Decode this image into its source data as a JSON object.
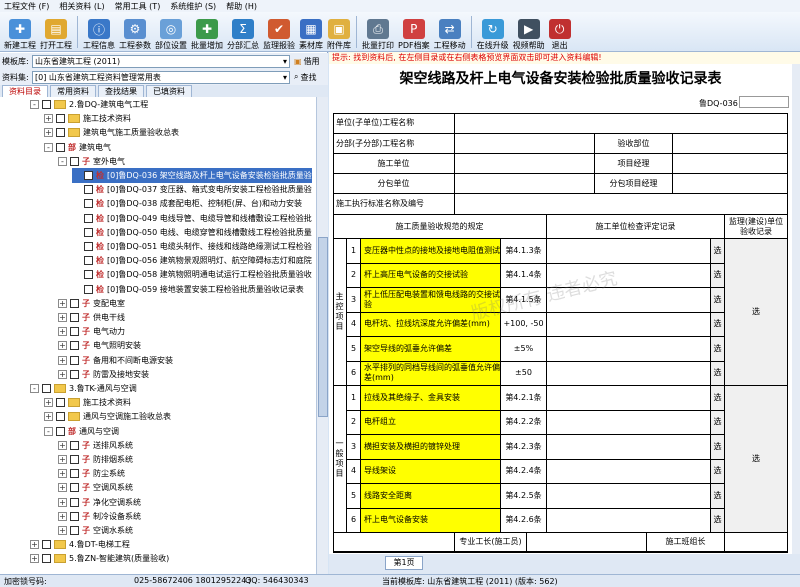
{
  "menu": [
    "工程文件 (F)",
    "相关资料 (L)",
    "常用工具 (T)",
    "系统维护 (S)",
    "帮助 (H)"
  ],
  "toolbar": [
    {
      "label": "新建工程",
      "icon": "new-project-icon",
      "color": "#4a90d9"
    },
    {
      "label": "打开工程",
      "icon": "open-project-icon",
      "color": "#e0a830"
    },
    {
      "label": "工程信息",
      "icon": "project-info-icon",
      "color": "#3a78c8"
    },
    {
      "label": "工程参数",
      "icon": "project-params-icon",
      "color": "#5a8fd0"
    },
    {
      "label": "部位设置",
      "icon": "position-settings-icon",
      "color": "#6aa0d8"
    },
    {
      "label": "批量增加",
      "icon": "batch-add-icon",
      "color": "#3c9a4a"
    },
    {
      "label": "分部汇总",
      "icon": "summary-icon",
      "color": "#2f7fc8"
    },
    {
      "label": "监理报验",
      "icon": "supervision-icon",
      "color": "#d05a30"
    },
    {
      "label": "素材库",
      "icon": "material-library-icon",
      "color": "#3a6fc4"
    },
    {
      "label": "附件库",
      "icon": "attachment-library-icon",
      "color": "#e0b040"
    },
    {
      "label": "批量打印",
      "icon": "batch-print-icon",
      "color": "#607890"
    },
    {
      "label": "PDF档案",
      "icon": "pdf-archive-icon",
      "color": "#d04040"
    },
    {
      "label": "工程移动",
      "icon": "project-move-icon",
      "color": "#4a80c0"
    },
    {
      "label": "在线升级",
      "icon": "online-upgrade-icon",
      "color": "#3a9ad8"
    },
    {
      "label": "视频帮助",
      "icon": "video-help-icon",
      "color": "#405060"
    },
    {
      "label": "退出",
      "icon": "exit-icon",
      "color": "#c03030"
    }
  ],
  "template_library": {
    "label": "模板库:",
    "value": "山东省建筑工程 (2011)",
    "action": "借用"
  },
  "data_set": {
    "label": "资料集:",
    "value": "[0] 山东省建筑工程资料管理常用表",
    "action": "查找"
  },
  "tabs": [
    "资料目录",
    "常用资料",
    "查找结果",
    "已填资料"
  ],
  "tree": [
    {
      "indent": 30,
      "text": "2.鲁DQ-建筑电气工程",
      "type": "folder",
      "exp": "-"
    },
    {
      "indent": 44,
      "text": "施工技术资料",
      "type": "folder",
      "exp": "+"
    },
    {
      "indent": 44,
      "text": "建筑电气施工质量验收总表",
      "type": "folder",
      "exp": "+"
    },
    {
      "indent": 44,
      "text": "建筑电气",
      "type": "badge",
      "badge": "部",
      "exp": "-"
    },
    {
      "indent": 58,
      "text": "室外电气",
      "type": "badge",
      "badge": "子",
      "exp": "-"
    },
    {
      "indent": 72,
      "text": "[0]鲁DQ-036 架空线路及杆上电气设备安装检验批质量验",
      "type": "badge",
      "badge": "检",
      "sel": true
    },
    {
      "indent": 72,
      "text": "[0]鲁DQ-037 变压器、箱式变电所安装工程检验批质量验",
      "type": "badge",
      "badge": "检"
    },
    {
      "indent": 72,
      "text": "[0]鲁DQ-038 成套配电柜、控制柜(屏、台)和动力安装",
      "type": "badge",
      "badge": "检"
    },
    {
      "indent": 72,
      "text": "[0]鲁DQ-049 电线导管、电缆导管和线槽敷设工程检验批",
      "type": "badge",
      "badge": "检"
    },
    {
      "indent": 72,
      "text": "[0]鲁DQ-050 电线、电缆穿管和线槽敷线工程检验批质量",
      "type": "badge",
      "badge": "检"
    },
    {
      "indent": 72,
      "text": "[0]鲁DQ-051 电缆头制作、接线和线路绝缘测试工程检验",
      "type": "badge",
      "badge": "检"
    },
    {
      "indent": 72,
      "text": "[0]鲁DQ-056 建筑物景观照明灯、航空障碍标志灯和庭院",
      "type": "badge",
      "badge": "检"
    },
    {
      "indent": 72,
      "text": "[0]鲁DQ-058 建筑物照明通电试运行工程检验批质量验收",
      "type": "badge",
      "badge": "检"
    },
    {
      "indent": 72,
      "text": "[0]鲁DQ-059 接地装置安装工程检验批质量验收记录表",
      "type": "badge",
      "badge": "检"
    },
    {
      "indent": 58,
      "text": "变配电室",
      "type": "badge",
      "badge": "子",
      "exp": "+"
    },
    {
      "indent": 58,
      "text": "供电干线",
      "type": "badge",
      "badge": "子",
      "exp": "+"
    },
    {
      "indent": 58,
      "text": "电气动力",
      "type": "badge",
      "badge": "子",
      "exp": "+"
    },
    {
      "indent": 58,
      "text": "电气照明安装",
      "type": "badge",
      "badge": "子",
      "exp": "+"
    },
    {
      "indent": 58,
      "text": "备用和不间断电源安装",
      "type": "badge",
      "badge": "子",
      "exp": "+"
    },
    {
      "indent": 58,
      "text": "防雷及接地安装",
      "type": "badge",
      "badge": "子",
      "exp": "+"
    },
    {
      "indent": 30,
      "text": "3.鲁TK-通风与空调",
      "type": "folder",
      "exp": "-"
    },
    {
      "indent": 44,
      "text": "施工技术资料",
      "type": "folder",
      "exp": "+"
    },
    {
      "indent": 44,
      "text": "通风与空调施工验收总表",
      "type": "folder",
      "exp": "+"
    },
    {
      "indent": 44,
      "text": "通风与空调",
      "type": "badge",
      "badge": "部",
      "exp": "-"
    },
    {
      "indent": 58,
      "text": "送排风系统",
      "type": "badge",
      "badge": "子",
      "exp": "+"
    },
    {
      "indent": 58,
      "text": "防排烟系统",
      "type": "badge",
      "badge": "子",
      "exp": "+"
    },
    {
      "indent": 58,
      "text": "防尘系统",
      "type": "badge",
      "badge": "子",
      "exp": "+"
    },
    {
      "indent": 58,
      "text": "空调风系统",
      "type": "badge",
      "badge": "子",
      "exp": "+"
    },
    {
      "indent": 58,
      "text": "净化空调系统",
      "type": "badge",
      "badge": "子",
      "exp": "+"
    },
    {
      "indent": 58,
      "text": "制冷设备系统",
      "type": "badge",
      "badge": "子",
      "exp": "+"
    },
    {
      "indent": 58,
      "text": "空调水系统",
      "type": "badge",
      "badge": "子",
      "exp": "+"
    },
    {
      "indent": 30,
      "text": "4.鲁DT-电梯工程",
      "type": "folder",
      "exp": "+"
    },
    {
      "indent": 30,
      "text": "5.鲁ZN-智能建筑(质量验收)",
      "type": "folder",
      "exp": "+"
    }
  ],
  "hint": "提示: 找到资料后, 在左侧目录或在右侧表格预览界面双击即可进入资料编辑!",
  "form": {
    "title": "架空线路及杆上电气设备安装检验批质量验收记录表",
    "code": "鲁DQ-036",
    "unit_project": "单位(子单位)工程名称",
    "sub_project": "分部(子分部)工程名称",
    "acceptance_part": "验收部位",
    "construction_unit": "施工单位",
    "project_manager": "项目经理",
    "subcontract_unit": "分包单位",
    "sub_project_manager": "分包项目经理",
    "standard": "施工执行标准名称及编号",
    "col_spec": "施工质量验收规范的规定",
    "col_check": "施工单位检查评定记录",
    "col_supervision": "监理(建设)单位验收记录",
    "main_label": "主控项目",
    "general_label": "一般项目",
    "main_items": [
      {
        "no": "1",
        "text": "变压器中性点的接地及接地电阻值测试",
        "ref": "第4.1.3条"
      },
      {
        "no": "2",
        "text": "杆上高压电气设备的交接试验",
        "ref": "第4.1.4条"
      },
      {
        "no": "3",
        "text": "杆上低压配电装置和馈电线路的交接试验",
        "ref": "第4.1.5条"
      },
      {
        "no": "4",
        "text": "电杆坑、拉线坑深度允许偏差(mm)",
        "ref": "+100, -50"
      },
      {
        "no": "5",
        "text": "架空导线的弧垂允许偏差",
        "ref": "±5%"
      },
      {
        "no": "6",
        "text": "水平排列的同档导线间的弧垂值允许偏差(mm)",
        "ref": "±50"
      }
    ],
    "general_items": [
      {
        "no": "1",
        "text": "拉线及其绝缘子、金具安装",
        "ref": "第4.2.1条"
      },
      {
        "no": "2",
        "text": "电杆组立",
        "ref": "第4.2.2条"
      },
      {
        "no": "3",
        "text": "横担安装及横担的镀锌处理",
        "ref": "第4.2.3条"
      },
      {
        "no": "4",
        "text": "导线架设",
        "ref": "第4.2.4条"
      },
      {
        "no": "5",
        "text": "线路安全距离",
        "ref": "第4.2.5条"
      },
      {
        "no": "6",
        "text": "杆上电气设备安装",
        "ref": "第4.2.6条"
      }
    ],
    "pick": "选",
    "foreman": "专业工长(施工员)",
    "team_leader": "施工班组长"
  },
  "watermarks": [
    "工程软件网",
    "版权所有 违者必究"
  ],
  "page_tab": "第1页",
  "status": {
    "lock_label": "加密锁号码:",
    "phone": "025-58672406 18012952243",
    "qq": "QQ: 546430343",
    "current": "当前模板库: 山东省建筑工程 (2011) (版本: 562)"
  }
}
